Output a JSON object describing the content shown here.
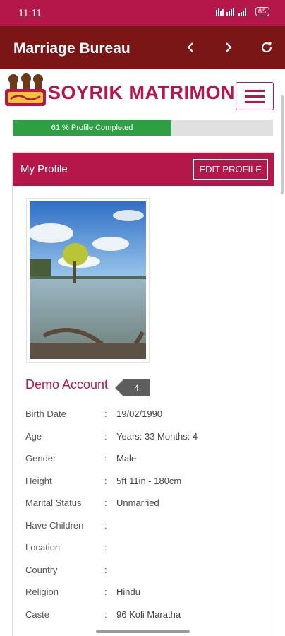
{
  "status": {
    "time": "11:11",
    "signal_text": "⋮⫾∿ ┆▆",
    "battery": "85"
  },
  "app": {
    "title": "Marriage Bureau"
  },
  "brand": {
    "name": "SOYRIK MATRIMONY"
  },
  "progress": {
    "label": "61 % Profile Completed",
    "percent": 61
  },
  "profile": {
    "card_title": "My Profile",
    "edit_label": "EDIT PROFILE",
    "name": "Demo Account",
    "badge": "4",
    "details": [
      {
        "label": "Birth Date",
        "value": "19/02/1990"
      },
      {
        "label": "Age",
        "value": "Years: 33 Months: 4"
      },
      {
        "label": "Gender",
        "value": "Male"
      },
      {
        "label": "Height",
        "value": "5ft 11in - 180cm"
      },
      {
        "label": "Marital Status",
        "value": "Unmarried"
      },
      {
        "label": "Have Children",
        "value": ""
      },
      {
        "label": "Location",
        "value": ""
      },
      {
        "label": "Country",
        "value": ""
      },
      {
        "label": "Religion",
        "value": "Hindu"
      },
      {
        "label": "Caste",
        "value": "96 Koli Maratha"
      }
    ],
    "colon": ":"
  },
  "colors": {
    "primary": "#b5174a",
    "app_bar": "#7b1617",
    "progress": "#2ea043"
  },
  "icons": [
    "chevron-left-icon",
    "chevron-right-icon",
    "refresh-icon",
    "hamburger-menu-icon"
  ]
}
